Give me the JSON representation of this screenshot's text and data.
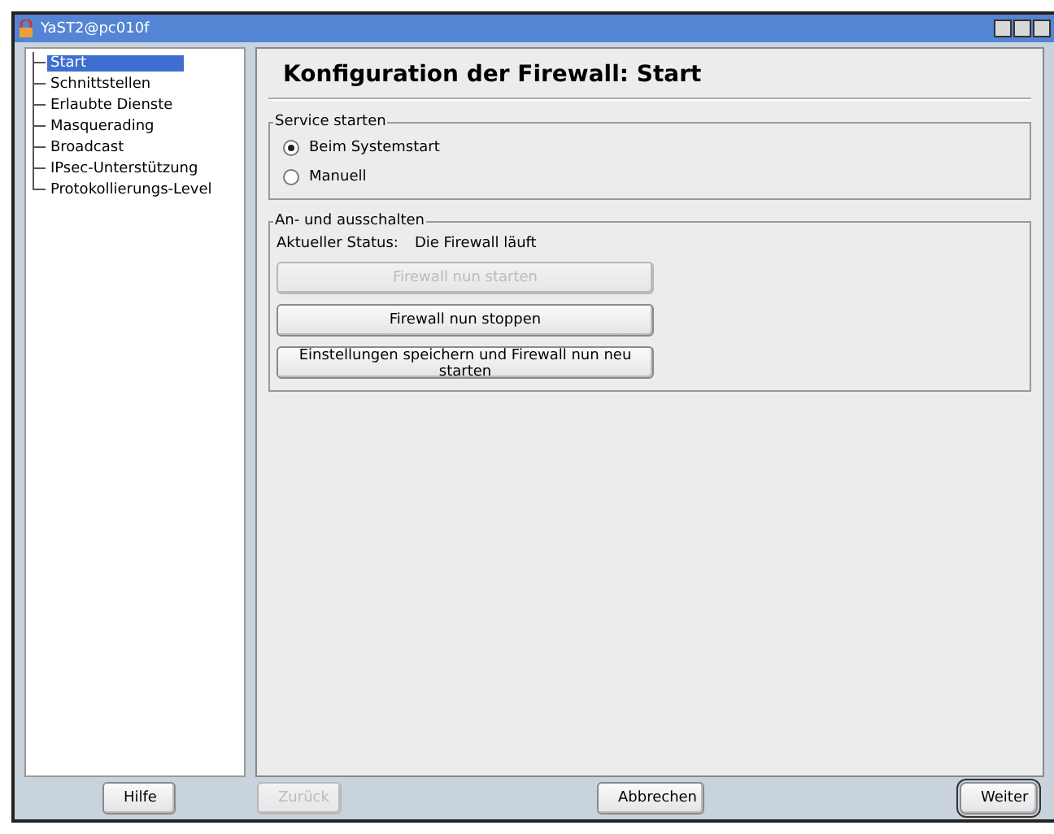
{
  "window": {
    "title": "YaST2@pc010f"
  },
  "sidebar": {
    "items": [
      {
        "label": "Start",
        "selected": true
      },
      {
        "label": "Schnittstellen",
        "selected": false
      },
      {
        "label": "Erlaubte Dienste",
        "selected": false
      },
      {
        "label": "Masquerading",
        "selected": false
      },
      {
        "label": "Broadcast",
        "selected": false
      },
      {
        "label": "IPsec-Unterstützung",
        "selected": false
      },
      {
        "label": "Protokollierungs-Level",
        "selected": false
      }
    ]
  },
  "heading": "Konfiguration der Firewall: Start",
  "service_group": {
    "title": "Service starten",
    "options": [
      {
        "label": "Beim Systemstart",
        "selected": true
      },
      {
        "label": "Manuell",
        "selected": false
      }
    ]
  },
  "switch_group": {
    "title": "An- und ausschalten",
    "status_label": "Aktueller Status:",
    "status_value": "Die Firewall läuft",
    "buttons": [
      {
        "label": "Firewall nun starten",
        "disabled": true
      },
      {
        "label": "Firewall nun stoppen",
        "disabled": false
      },
      {
        "label": "Einstellungen speichern und Firewall nun neu starten",
        "disabled": false
      }
    ]
  },
  "footer_buttons": [
    {
      "label": "Hilfe",
      "disabled": false,
      "default": false
    },
    {
      "label": "Zurück",
      "disabled": true,
      "default": false
    },
    {
      "label": "Abbrechen",
      "disabled": false,
      "default": false
    },
    {
      "label": "Weiter",
      "disabled": false,
      "default": true
    }
  ]
}
